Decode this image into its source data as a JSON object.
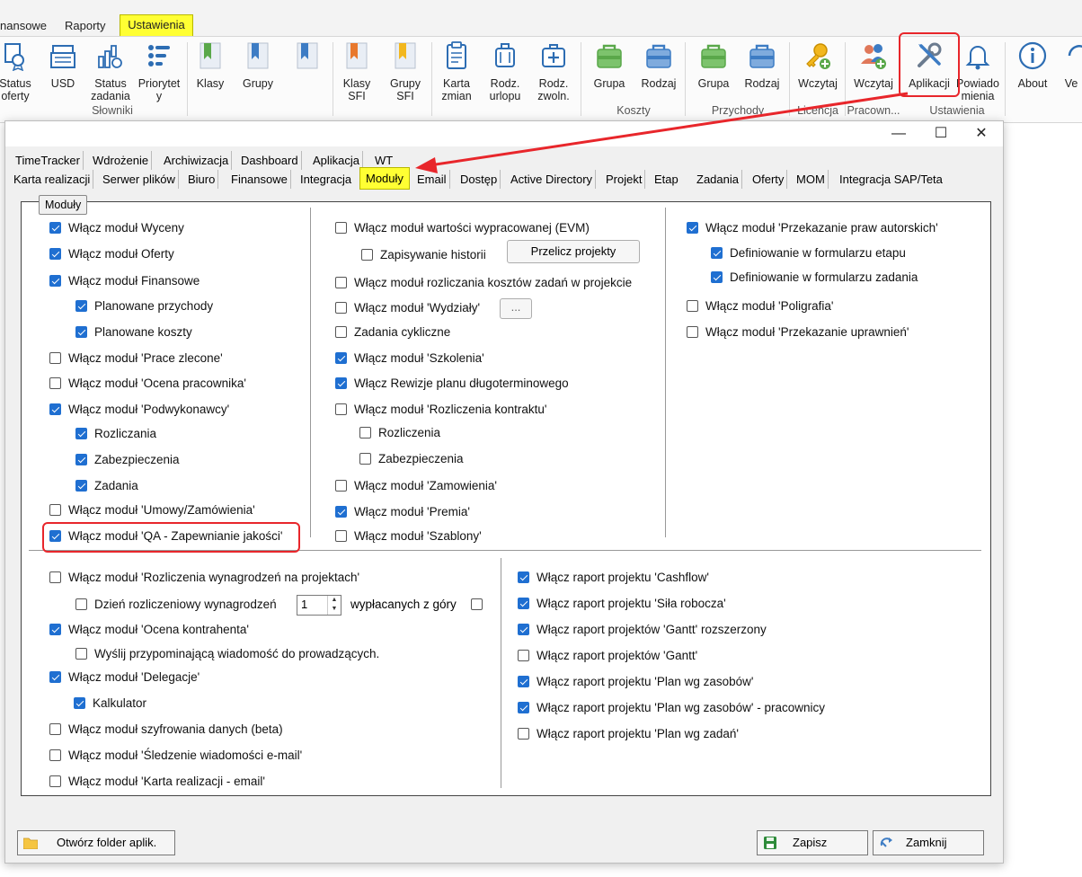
{
  "ribbon_tabs": [
    "nansowe",
    "Raporty",
    "Ustawienia"
  ],
  "ribbon_buttons": [
    {
      "label": "Status\noferty",
      "icon": "certificate-icon"
    },
    {
      "label": "USD",
      "icon": "cash-register-icon"
    },
    {
      "label": "Status\nzadania",
      "icon": "chart-settings-icon"
    },
    {
      "label": "Priorytet\ny",
      "icon": "priority-list-icon"
    },
    {
      "label": "Klasy",
      "icon": "bookmark-green-icon"
    },
    {
      "label": "Grupy",
      "icon": "bookmark-blue-icon"
    },
    {
      "label": "",
      "icon": "bookmark-blue-icon"
    },
    {
      "label": "Klasy\nSFI",
      "icon": "bookmark-orange-icon"
    },
    {
      "label": "Grupy\nSFI",
      "icon": "bookmark-yellow-icon"
    },
    {
      "label": "Karta\nzmian",
      "icon": "clipboard-icon"
    },
    {
      "label": "Rodz.\nurlopu",
      "icon": "suitcase-icon"
    },
    {
      "label": "Rodz.\nzwoln.",
      "icon": "medical-kit-icon"
    },
    {
      "label": "Grupa",
      "icon": "green-bag-icon"
    },
    {
      "label": "Rodzaj",
      "icon": "blue-bag-icon"
    },
    {
      "label": "Grupa",
      "icon": "green-bag-icon"
    },
    {
      "label": "Rodzaj",
      "icon": "blue-bag-icon"
    },
    {
      "label": "Wczytaj",
      "icon": "key-add-icon"
    },
    {
      "label": "Wczytaj",
      "icon": "users-add-icon"
    },
    {
      "label": "Aplikacji",
      "icon": "tools-icon"
    },
    {
      "label": "Powiado\nmienia",
      "icon": "bell-icon"
    },
    {
      "label": "About",
      "icon": "info-icon"
    },
    {
      "label": "Ve",
      "icon": "refresh-icon"
    }
  ],
  "ribbon_groups": [
    "Słowniki",
    "Koszty",
    "Przychody",
    "Licencja",
    "Pracown...",
    "Ustawienia"
  ],
  "tabs_row1": [
    "TimeTracker",
    "Wdrożenie",
    "Archiwizacja",
    "Dashboard",
    "Aplikacja",
    "WT"
  ],
  "tabs_row2": [
    "Karta realizacji",
    "Serwer plików",
    "Biuro",
    "Finansowe",
    "Integracja",
    "Moduły",
    "Email",
    "Dostęp",
    "Active Directory",
    "Projekt",
    "Etap",
    "Zadania",
    "Oferty",
    "MOM",
    "Integracja SAP/Teta"
  ],
  "group_label": "Moduły",
  "col1": [
    {
      "label": "Włącz moduł Wyceny",
      "checked": true
    },
    {
      "label": "Włącz moduł Oferty",
      "checked": true
    },
    {
      "label": "Włącz moduł Finansowe",
      "checked": true
    },
    {
      "label": "Planowane przychody",
      "checked": true
    },
    {
      "label": "Planowane koszty",
      "checked": true
    },
    {
      "label": "Włącz moduł 'Prace zlecone'",
      "checked": false
    },
    {
      "label": "Włącz moduł 'Ocena pracownika'",
      "checked": false
    },
    {
      "label": "Włącz moduł 'Podwykonawcy'",
      "checked": true
    },
    {
      "label": "Rozliczania",
      "checked": true
    },
    {
      "label": "Zabezpieczenia",
      "checked": true
    },
    {
      "label": "Zadania",
      "checked": true
    },
    {
      "label": "Włącz moduł 'Umowy/Zamówienia'",
      "checked": false
    },
    {
      "label": "Włącz moduł 'QA - Zapewnianie jakości'",
      "checked": true
    }
  ],
  "col2": [
    {
      "label": "Włącz moduł wartości wypracowanej (EVM)",
      "checked": false
    },
    {
      "label": "Zapisywanie historii",
      "checked": false
    },
    {
      "label": "Włącz moduł rozliczania kosztów zadań w projekcie",
      "checked": false
    },
    {
      "label": "Włącz moduł 'Wydziały'",
      "checked": false
    },
    {
      "label": "Zadania cykliczne",
      "checked": false
    },
    {
      "label": "Włącz moduł 'Szkolenia'",
      "checked": true
    },
    {
      "label": "Włącz Rewizje planu długoterminowego",
      "checked": true
    },
    {
      "label": "Włącz moduł 'Rozliczenia kontraktu'",
      "checked": false
    },
    {
      "label": "Rozliczenia",
      "checked": false
    },
    {
      "label": "Zabezpieczenia",
      "checked": false
    },
    {
      "label": "Włącz moduł 'Zamowienia'",
      "checked": false
    },
    {
      "label": "Włącz moduł 'Premia'",
      "checked": true
    },
    {
      "label": "Włącz moduł 'Szablony'",
      "checked": false
    }
  ],
  "col3": [
    {
      "label": "Włącz moduł 'Przekazanie praw autorskich'",
      "checked": true
    },
    {
      "label": "Definiowanie w formularzu etapu",
      "checked": true
    },
    {
      "label": "Definiowanie w formularzu zadania",
      "checked": true
    },
    {
      "label": "Włącz moduł 'Poligrafia'",
      "checked": false
    },
    {
      "label": "Włącz moduł 'Przekazanie uprawnień'",
      "checked": false
    }
  ],
  "col4": [
    {
      "label": "Włącz moduł 'Rozliczenia wynagrodzeń na projektach'",
      "checked": false
    },
    {
      "label": "Dzień rozliczeniowy wynagrodzeń",
      "checked": false
    },
    {
      "label": "Włącz moduł 'Ocena kontrahenta'",
      "checked": true
    },
    {
      "label": "Wyślij  przypominającą wiadomość do prowadzących.",
      "checked": false
    },
    {
      "label": "Włącz moduł 'Delegacje'",
      "checked": true
    },
    {
      "label": "Kalkulator",
      "checked": true
    },
    {
      "label": "Włącz moduł szyfrowania danych (beta)",
      "checked": false
    },
    {
      "label": "Włącz moduł 'Śledzenie wiadomości e-mail'",
      "checked": false
    },
    {
      "label": "Włącz moduł 'Karta realizacji - email'",
      "checked": false
    }
  ],
  "col5": [
    {
      "label": "Włącz raport projektu 'Cashflow'",
      "checked": true
    },
    {
      "label": "Włącz raport projektu 'Siła robocza'",
      "checked": true
    },
    {
      "label": "Włącz raport projektów 'Gantt' rozszerzony",
      "checked": true
    },
    {
      "label": "Włącz raport projektów 'Gantt'",
      "checked": false
    },
    {
      "label": "Włącz raport projektu 'Plan wg zasobów'",
      "checked": true
    },
    {
      "label": "Włącz raport projektu 'Plan wg zasobów' - pracownicy",
      "checked": true
    },
    {
      "label": "Włącz raport projektu 'Plan wg zadań'",
      "checked": false
    }
  ],
  "recalc_button": "Przelicz projekty",
  "ellipsis_button": "...",
  "day_value": "1",
  "upfront_label": "wypłacanych z góry",
  "upfront_checked": false,
  "open_folder_button": "Otwórz folder aplik.",
  "save_button": "Zapisz",
  "close_button": "Zamknij",
  "window_controls": {
    "minimize": "—",
    "maximize": "☐",
    "close": "✕"
  },
  "accent_color": "#1f6fd1",
  "highlight_color": "#e8262b"
}
